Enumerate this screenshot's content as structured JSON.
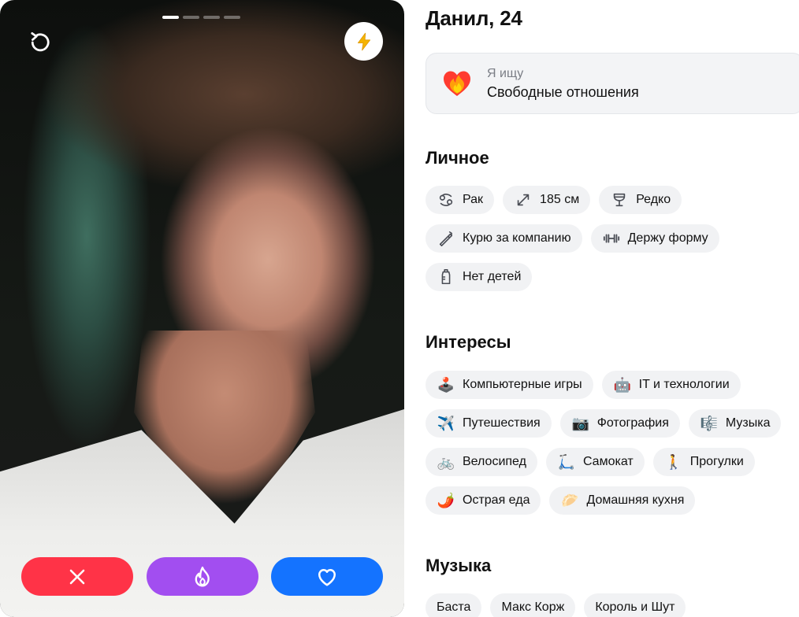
{
  "photo": {
    "total_photos": 4,
    "current_photo": 1
  },
  "actions": {
    "undo_icon": "undo-icon",
    "boost_icon": "lightning-icon",
    "dislike_icon": "close-icon",
    "superlike_icon": "flame-icon",
    "like_icon": "heart-icon",
    "colors": {
      "dislike": "#ff3347",
      "superlike": "#a24ef0",
      "like": "#1473ff",
      "boost_icon": "#f5b400"
    }
  },
  "profile": {
    "name_age": "Данил, 24",
    "looking_for": {
      "icon": "fire-heart-icon",
      "label": "Я ищу",
      "value": "Свободные отношения"
    },
    "personal": {
      "title": "Личное",
      "chips": [
        {
          "icon": "cancer-zodiac-icon",
          "label": "Рак"
        },
        {
          "icon": "height-icon",
          "label": "185 см"
        },
        {
          "icon": "wine-glass-icon",
          "label": "Редко"
        },
        {
          "icon": "cigarette-icon",
          "label": "Курю за компанию"
        },
        {
          "icon": "dumbbell-icon",
          "label": "Держу форму"
        },
        {
          "icon": "baby-bottle-icon",
          "label": "Нет детей"
        }
      ]
    },
    "interests": {
      "title": "Интересы",
      "chips": [
        {
          "icon": "joystick-icon",
          "label": "Компьютерные игры"
        },
        {
          "icon": "robot-icon",
          "label": "IT и технологии"
        },
        {
          "icon": "airplane-icon",
          "label": "Путешествия"
        },
        {
          "icon": "camera-icon",
          "label": "Фотография"
        },
        {
          "icon": "music-score-icon",
          "label": "Музыка"
        },
        {
          "icon": "bicycle-icon",
          "label": "Велосипед"
        },
        {
          "icon": "scooter-icon",
          "label": "Самокат"
        },
        {
          "icon": "walking-icon",
          "label": "Прогулки"
        },
        {
          "icon": "chili-pepper-icon",
          "label": "Острая еда"
        },
        {
          "icon": "leafy-dish-icon",
          "label": "Домашняя кухня"
        }
      ]
    },
    "music": {
      "title": "Музыка",
      "chips": [
        {
          "label": "Баста"
        },
        {
          "label": "Макс Корж"
        },
        {
          "label": "Король и Шут"
        }
      ]
    }
  }
}
